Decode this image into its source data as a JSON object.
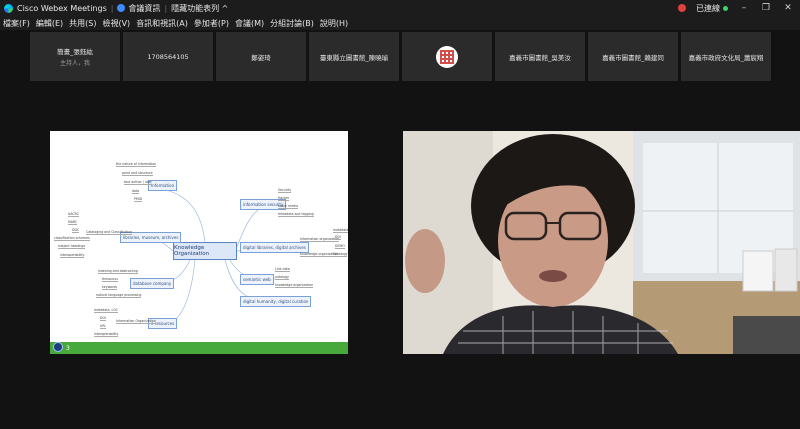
{
  "titlebar": {
    "app_name": "Cisco Webex Meetings",
    "meeting_info": "會議資訊",
    "hide_toolbar": "隱藏功能表列 ^",
    "connection_status": "已連線"
  },
  "menu": [
    "檔案(F)",
    "編輯(E)",
    "共用(S)",
    "檢視(V)",
    "音訊和視訊(A)",
    "參加者(P)",
    "會議(M)",
    "分組討論(B)",
    "說明(H)"
  ],
  "participants": [
    {
      "name": "簡畫_張鈺紘",
      "sub": "主持人，我"
    },
    {
      "name": "1708564105",
      "sub": ""
    },
    {
      "name": "鄭姿琦",
      "sub": ""
    },
    {
      "name": "臺東縣立圖書館_陳曉瑜",
      "sub": ""
    },
    {
      "name": "",
      "sub": "",
      "avatar": "qr-code"
    },
    {
      "name": "嘉義市圖書館_吳美汝",
      "sub": ""
    },
    {
      "name": "嘉義市圖書館_賴建同",
      "sub": ""
    },
    {
      "name": "嘉義市政府文化局_蕭宸翔",
      "sub": ""
    }
  ],
  "slide": {
    "center": "Knowledge Organization",
    "branches": [
      "Information",
      "libraries, museum, archives",
      "database company",
      "e-resources",
      "information security",
      "digital libraries, digital archives",
      "semantic web",
      "digital humanity, digital curation"
    ],
    "leaves": [
      "the nature of information",
      "point and structure",
      "text author / user",
      "data",
      "PMID",
      "AACR2",
      "MARC",
      "DDC",
      "classification schemes",
      "subject headings",
      "interoperability",
      "Cataloging and Classification",
      "indexing and abstracting",
      "thesaurus",
      "keywords",
      "natural language processing",
      "metadata, LOC",
      "DOI",
      "URI",
      "interoperability",
      "Information Organization",
      "Security",
      "Hacker",
      "social media",
      "metadata and tagging",
      "Information organization",
      "metadata",
      "DOI",
      "Knowledge organization",
      "DEMO",
      "Ontology",
      "Link data",
      "ontology",
      "knowledge organization"
    ],
    "page_number": "3"
  },
  "colors": {
    "accent_green": "#47a83b",
    "node_blue": "#5b84c4",
    "record_red": "#e0413a"
  }
}
